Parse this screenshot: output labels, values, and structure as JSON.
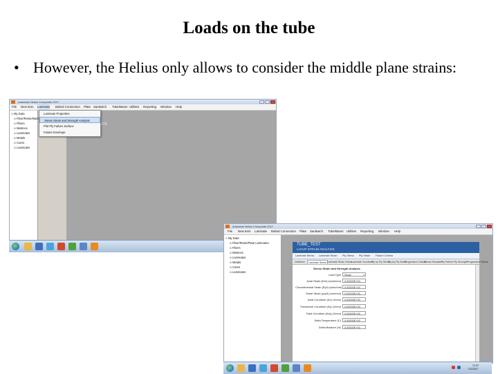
{
  "slide": {
    "title": "Loads on the tube",
    "bullet_marker": "•",
    "bullet_text": "However, the Helius only allows to consider the middle plane strains:"
  },
  "screenshot1": {
    "window_title": "Autodesk Helius Composite 2017",
    "menus": [
      "File",
      "New Item",
      "Laminate",
      "Bolted Connection",
      "Plate",
      "Sandwich",
      "Tube/Beam",
      "Utilities",
      "Reporting",
      "Window",
      "Help"
    ],
    "tree": [
      "My Data",
      "Fiber/Resin/Matrix",
      "Fibers",
      "Matrices",
      "Laminates",
      "Metals",
      "Cores",
      "Laminates"
    ],
    "dropdown": [
      "Laminate Properties",
      "Stress Strain and Strength Analysis",
      "Plot Ply Failure Surface",
      "Failure Envelope"
    ],
    "highlighted_index": 1,
    "workspace_label": "SITE"
  },
  "screenshot2": {
    "window_title": "Autodesk Helius Composite 2017",
    "menus": [
      "File",
      "New Item",
      "Laminate",
      "Bolted Connection",
      "Plate",
      "Sandwich",
      "Tube/Beam",
      "Utilities",
      "Reporting",
      "Window",
      "Help"
    ],
    "tree": [
      "My Data",
      "Fiber/Resin/Plate Laminates",
      "Fibers",
      "Matrices",
      "Laminates",
      "Metals",
      "Cores",
      "Laminates"
    ],
    "panel_title": "TUBE_TEST",
    "panel_subtitle": "LAYUP STRAIN ANALYSIS",
    "sub_tabs": [
      "Laminate Stress",
      "Laminate Strain",
      "Ply Stress",
      "Ply Strain",
      "Failure Criteria"
    ],
    "tabs": [
      "Definition",
      "Laminate Stress",
      "Laminate Strain Stress",
      "Laminate Curvature",
      "Ply by Ply Stress",
      "Ply-by-Ply Strain",
      "Progressive Failure",
      "Stress Resultant",
      "Ply Failure",
      "Ply Strength",
      "Progressive Failure"
    ],
    "active_tab": 1,
    "form_heading": "Stress Strain and Strength Analysis",
    "form": [
      {
        "label": "Load Type",
        "value": "Strain",
        "select": true
      },
      {
        "label": "Axial Strain (Ex0) ε(mm/mm)",
        "value": "0.00000E+00"
      },
      {
        "label": "Circumferential Strain (Ey0) ε(mm/mm)",
        "value": "0.00000E+00"
      },
      {
        "label": "Shear Strain (γxy0) (mm/mm)",
        "value": "0.00000E+00"
      },
      {
        "label": "Axial Curvature (Kx) (1/mm)",
        "value": "0.00000E+00"
      },
      {
        "label": "Transverse Curvature (Ky) (1/mm)",
        "value": "0.00000E+00"
      },
      {
        "label": "Twist Curvature (Kxy) (1/mm)",
        "value": "0.00000E+00"
      },
      {
        "label": "Delta Temperature (C)",
        "value": "0.00000E+00"
      },
      {
        "label": "Delta Moisture (%)",
        "value": "0.00000E+00"
      }
    ],
    "clock_time": "11:07",
    "clock_date": "5/22/2017"
  },
  "colors": {
    "workspace": "#a6a6a6",
    "highlight": "#cfe0f5",
    "panel_header": "#2d5fa3",
    "taskbar": "#a9bfd9"
  }
}
